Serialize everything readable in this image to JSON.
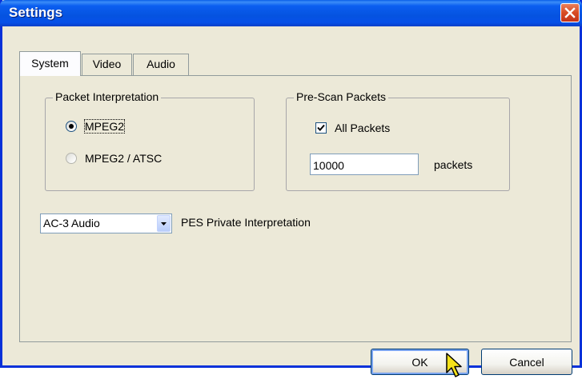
{
  "window": {
    "title": "Settings",
    "accent_color": "#0553e0",
    "close_icon": "close-icon"
  },
  "tabs": [
    {
      "label": "System",
      "active": true
    },
    {
      "label": "Video",
      "active": false
    },
    {
      "label": "Audio",
      "active": false
    }
  ],
  "packet_interpretation": {
    "label": "Packet Interpretation",
    "options": [
      {
        "label": "MPEG2",
        "selected": true
      },
      {
        "label": "MPEG2 / ATSC",
        "selected": false
      }
    ]
  },
  "prescan": {
    "label": "Pre-Scan Packets",
    "all_packets_label": "All Packets",
    "all_packets_checked": true,
    "count_value": "10000",
    "unit_label": "packets"
  },
  "pes": {
    "selected": "AC-3 Audio",
    "label": "PES Private Interpretation"
  },
  "buttons": {
    "ok": "OK",
    "cancel": "Cancel"
  },
  "cursor_icon": "pointer-cursor-icon"
}
